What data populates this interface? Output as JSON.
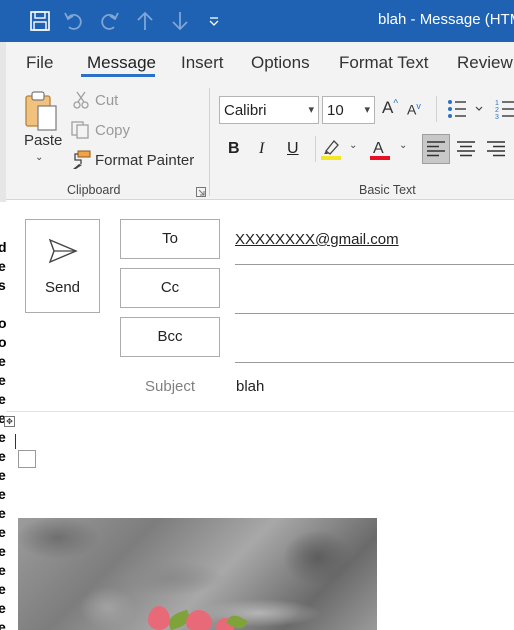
{
  "window": {
    "title": "blah  -  Message (HTML)"
  },
  "tabs": [
    {
      "label": "File"
    },
    {
      "label": "Message"
    },
    {
      "label": "Insert"
    },
    {
      "label": "Options"
    },
    {
      "label": "Format Text"
    },
    {
      "label": "Review"
    }
  ],
  "ribbon": {
    "clipboard": {
      "paste_label": "Paste",
      "cut_label": "Cut",
      "copy_label": "Copy",
      "format_painter_label": "Format Painter",
      "group_label": "Clipboard"
    },
    "basic_text": {
      "font_name": "Calibri",
      "font_size": "10",
      "bold_label": "B",
      "italic_label": "I",
      "underline_label": "U",
      "font_color_label": "A",
      "group_label": "Basic Text"
    }
  },
  "compose": {
    "send_label": "Send",
    "to_label": "To",
    "cc_label": "Cc",
    "bcc_label": "Bcc",
    "to_value": "XXXXXXXX@gmail.com",
    "subject_label": "Subject",
    "subject_value": "blah"
  },
  "background_doc_chars": [
    "d",
    "e",
    "s",
    "",
    "o",
    "o",
    "e",
    "e",
    "e",
    "e",
    "e",
    "e",
    "e",
    "e",
    "e",
    "e",
    "e",
    "e",
    "e",
    "e",
    "e"
  ],
  "colors": {
    "titlebar": "#1f62b3",
    "accent": "#2b72c6",
    "highlight_yellow": "#f5e625",
    "font_red": "#e81123"
  },
  "icons": [
    "save-icon",
    "undo-icon",
    "redo-icon",
    "up-arrow-icon",
    "down-arrow-icon",
    "customize-qat-icon",
    "paste-icon",
    "cut-icon",
    "copy-icon",
    "format-painter-icon",
    "grow-font-icon",
    "shrink-font-icon",
    "bullets-icon",
    "numbering-icon",
    "highlight-icon",
    "font-color-icon",
    "align-left-icon",
    "align-center-icon",
    "align-right-icon",
    "send-icon",
    "dialog-launcher-icon"
  ]
}
